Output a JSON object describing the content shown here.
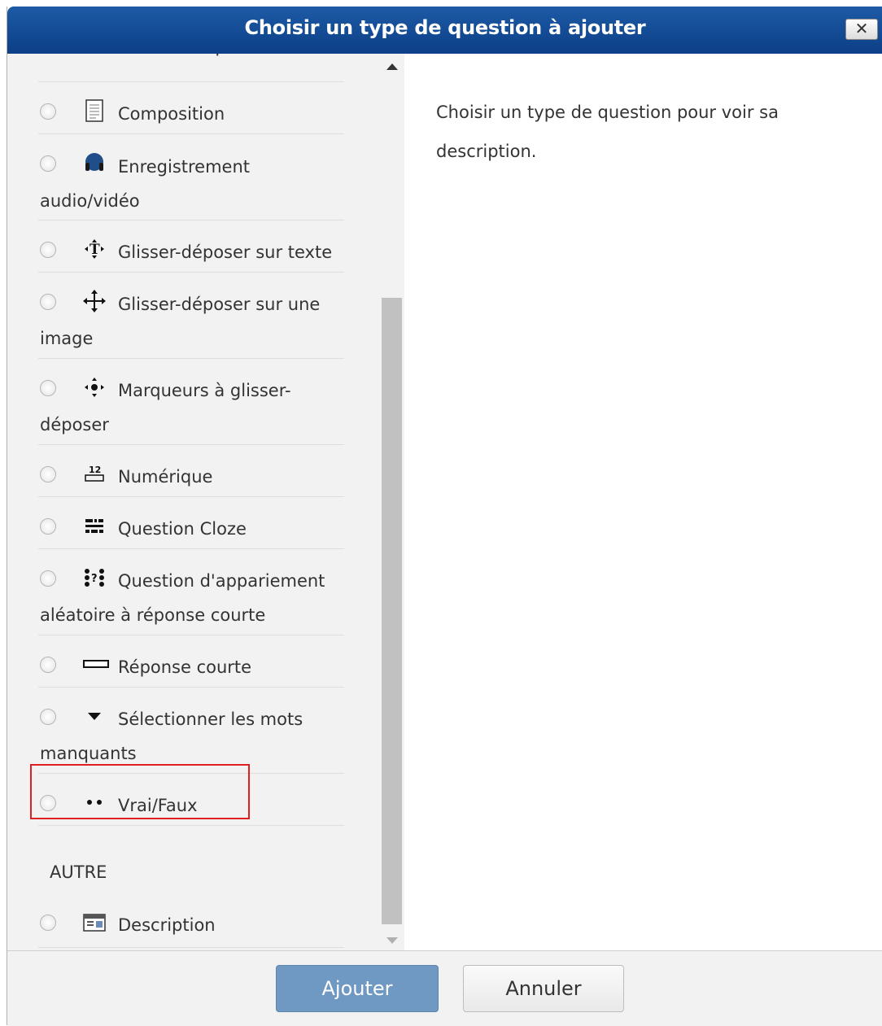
{
  "dialog": {
    "title": "Choisir un type de question à ajouter",
    "close_icon": "close-icon",
    "close_glyph": "✕"
  },
  "list": {
    "items": [
      {
        "label": "Choix multiple",
        "icon": "multichoice-icon"
      },
      {
        "label": "Composition",
        "icon": "essay-icon"
      },
      {
        "label": "Enregistrement",
        "label2": "audio/vidéo",
        "icon": "audio-video-recording-icon"
      },
      {
        "label": "Glisser-déposer sur texte",
        "icon": "drag-drop-text-icon"
      },
      {
        "label": "Glisser-déposer sur une",
        "label2": "image",
        "icon": "drag-drop-image-icon"
      },
      {
        "label": "Marqueurs à glisser-",
        "label2": "déposer",
        "icon": "drag-drop-markers-icon"
      },
      {
        "label": "Numérique",
        "icon": "numerical-icon"
      },
      {
        "label": "Question Cloze",
        "icon": "cloze-icon"
      },
      {
        "label": "Question d'appariement",
        "label2": "aléatoire à réponse courte",
        "icon": "random-short-answer-matching-icon"
      },
      {
        "label": "Réponse courte",
        "icon": "short-answer-icon"
      },
      {
        "label": "Sélectionner les mots",
        "label2": "manquants",
        "icon": "select-missing-words-icon"
      },
      {
        "label": "Vrai/Faux",
        "icon": "true-false-icon"
      }
    ],
    "section_other": "AUTRE",
    "other_items": [
      {
        "label": "Description",
        "icon": "description-icon"
      }
    ]
  },
  "description_panel": {
    "text": "Choisir un type de question pour voir sa description."
  },
  "footer": {
    "add_label": "Ajouter",
    "cancel_label": "Annuler"
  },
  "colors": {
    "title_bar": "#0c3f86",
    "add_button": "#6f98c3",
    "highlight_border": "#e02020"
  }
}
